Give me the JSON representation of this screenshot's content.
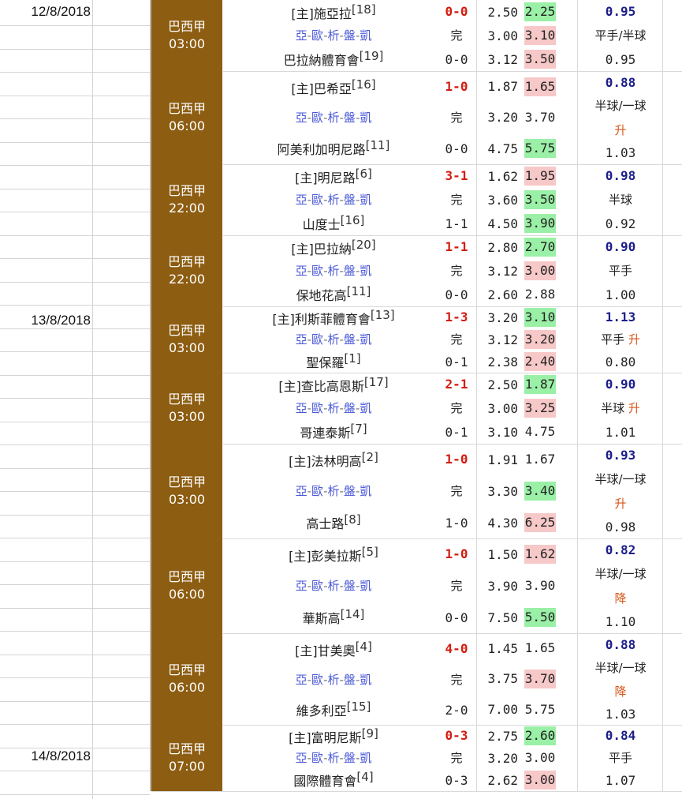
{
  "dates": [
    "12/8/2018",
    "13/8/2018",
    "14/8/2018"
  ],
  "colors": {
    "league_bg": "#8d5d12",
    "score": "#d41c10",
    "handicap_top": "#1c1e8a",
    "link": "#4a58d8",
    "odds_up": "#f7c8c8",
    "odds_down": "#9af0a6",
    "trend": "#d8561a"
  },
  "links": [
    "亞",
    "歐",
    "析",
    "盤",
    "凱"
  ],
  "link_sep": "-",
  "matches": [
    {
      "league": "巴西甲",
      "time": "03:00",
      "home": "[主]施亞拉",
      "home_rank": "[18]",
      "away": "巴拉納體育會",
      "away_rank": "[19]",
      "ft": "0-0",
      "status": "完",
      "ht": "0-0",
      "odds": [
        [
          "2.50",
          "2.25",
          "down"
        ],
        [
          "3.00",
          "3.10",
          "up"
        ],
        [
          "3.12",
          "3.50",
          "up"
        ]
      ],
      "hc_top": "0.95",
      "hc_line1": "平手/半球",
      "hc_line2": "",
      "hc_bot": "0.95"
    },
    {
      "league": "巴西甲",
      "time": "06:00",
      "home": "[主]巴希亞",
      "home_rank": "[16]",
      "away": "阿美利加明尼路",
      "away_rank": "[11]",
      "ft": "1-0",
      "status": "完",
      "ht": "0-0",
      "odds": [
        [
          "1.87",
          "1.65",
          "up"
        ],
        [
          "3.20",
          "3.70",
          "none"
        ],
        [
          "4.75",
          "5.75",
          "down"
        ]
      ],
      "hc_top": "0.88",
      "hc_line1": "半球/一球",
      "hc_line2": "升",
      "hc_bot": "1.03"
    },
    {
      "league": "巴西甲",
      "time": "22:00",
      "home": "[主]明尼路",
      "home_rank": "[6]",
      "away": "山度士",
      "away_rank": "[16]",
      "ft": "3-1",
      "status": "完",
      "ht": "1-1",
      "odds": [
        [
          "1.62",
          "1.95",
          "up"
        ],
        [
          "3.60",
          "3.50",
          "down"
        ],
        [
          "4.50",
          "3.90",
          "down"
        ]
      ],
      "hc_top": "0.98",
      "hc_line1": "半球",
      "hc_line2": "",
      "hc_bot": "0.92"
    },
    {
      "league": "巴西甲",
      "time": "22:00",
      "home": "[主]巴拉納",
      "home_rank": "[20]",
      "away": "保地花高",
      "away_rank": "[11]",
      "ft": "1-1",
      "status": "完",
      "ht": "0-0",
      "odds": [
        [
          "2.80",
          "2.70",
          "down"
        ],
        [
          "3.12",
          "3.00",
          "up"
        ],
        [
          "2.60",
          "2.88",
          "none"
        ]
      ],
      "hc_top": "0.90",
      "hc_line1": "平手",
      "hc_line2": "",
      "hc_bot": "1.00"
    },
    {
      "league": "巴西甲",
      "time": "03:00",
      "home": "[主]利斯菲體育會",
      "home_rank": "[13]",
      "away": "聖保羅",
      "away_rank": "[1]",
      "ft": "1-3",
      "status": "完",
      "ht": "0-1",
      "odds": [
        [
          "3.20",
          "3.10",
          "down"
        ],
        [
          "3.12",
          "3.20",
          "up"
        ],
        [
          "2.38",
          "2.40",
          "up"
        ]
      ],
      "hc_top": "1.13",
      "hc_line1": "平手",
      "hc_line1_trend": "升",
      "hc_line2": "",
      "hc_bot": "0.80"
    },
    {
      "league": "巴西甲",
      "time": "03:00",
      "home": "[主]查比高恩斯",
      "home_rank": "[17]",
      "away": "哥連泰斯",
      "away_rank": "[7]",
      "ft": "2-1",
      "status": "完",
      "ht": "0-1",
      "odds": [
        [
          "2.50",
          "1.87",
          "down"
        ],
        [
          "3.00",
          "3.25",
          "up"
        ],
        [
          "3.10",
          "4.75",
          "none"
        ]
      ],
      "hc_top": "0.90",
      "hc_line1": "半球",
      "hc_line1_trend": "升",
      "hc_line2": "",
      "hc_bot": "1.01"
    },
    {
      "league": "巴西甲",
      "time": "03:00",
      "home": "[主]法林明高",
      "home_rank": "[2]",
      "away": "高士路",
      "away_rank": "[8]",
      "ft": "1-0",
      "status": "完",
      "ht": "1-0",
      "odds": [
        [
          "1.91",
          "1.67",
          "none"
        ],
        [
          "3.30",
          "3.40",
          "down"
        ],
        [
          "4.30",
          "6.25",
          "up"
        ]
      ],
      "hc_top": "0.93",
      "hc_line1": "半球/一球",
      "hc_line2": "升",
      "hc_bot": "0.98"
    },
    {
      "league": "巴西甲",
      "time": "06:00",
      "home": "[主]彭美拉斯",
      "home_rank": "[5]",
      "away": "華斯高",
      "away_rank": "[14]",
      "ft": "1-0",
      "status": "完",
      "ht": "0-0",
      "odds": [
        [
          "1.50",
          "1.62",
          "up"
        ],
        [
          "3.90",
          "3.90",
          "none"
        ],
        [
          "7.50",
          "5.50",
          "down"
        ]
      ],
      "hc_top": "0.82",
      "hc_line1": "半球/一球",
      "hc_line2": "降",
      "hc_bot": "1.10"
    },
    {
      "league": "巴西甲",
      "time": "06:00",
      "home": "[主]甘美奧",
      "home_rank": "[4]",
      "away": "維多利亞",
      "away_rank": "[15]",
      "ft": "4-0",
      "status": "完",
      "ht": "2-0",
      "odds": [
        [
          "1.45",
          "1.65",
          "none"
        ],
        [
          "3.75",
          "3.70",
          "up"
        ],
        [
          "7.00",
          "5.75",
          "none"
        ]
      ],
      "hc_top": "0.88",
      "hc_line1": "半球/一球",
      "hc_line2": "降",
      "hc_bot": "1.03"
    },
    {
      "league": "巴西甲",
      "time": "07:00",
      "home": "[主]富明尼斯",
      "home_rank": "[9]",
      "away": "國際體育會",
      "away_rank": "[4]",
      "ft": "0-3",
      "status": "完",
      "ht": "0-3",
      "odds": [
        [
          "2.75",
          "2.60",
          "down"
        ],
        [
          "3.20",
          "3.00",
          "none"
        ],
        [
          "2.62",
          "3.00",
          "up"
        ]
      ],
      "hc_top": "0.84",
      "hc_line1": "平手",
      "hc_line2": "",
      "hc_bot": "1.07"
    }
  ]
}
